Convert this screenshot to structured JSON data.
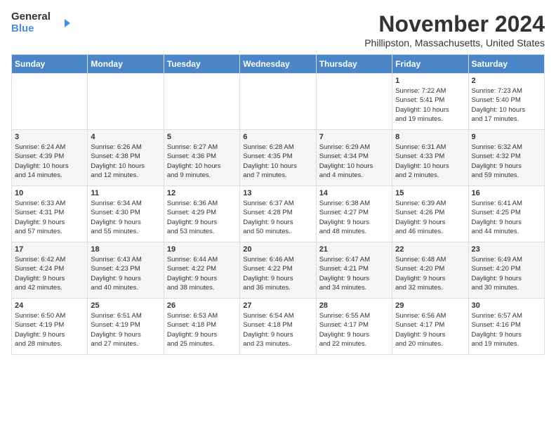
{
  "logo": {
    "line1": "General",
    "line2": "Blue"
  },
  "title": "November 2024",
  "location": "Phillipston, Massachusetts, United States",
  "days_of_week": [
    "Sunday",
    "Monday",
    "Tuesday",
    "Wednesday",
    "Thursday",
    "Friday",
    "Saturday"
  ],
  "weeks": [
    [
      {
        "day": "",
        "info": ""
      },
      {
        "day": "",
        "info": ""
      },
      {
        "day": "",
        "info": ""
      },
      {
        "day": "",
        "info": ""
      },
      {
        "day": "",
        "info": ""
      },
      {
        "day": "1",
        "info": "Sunrise: 7:22 AM\nSunset: 5:41 PM\nDaylight: 10 hours\nand 19 minutes."
      },
      {
        "day": "2",
        "info": "Sunrise: 7:23 AM\nSunset: 5:40 PM\nDaylight: 10 hours\nand 17 minutes."
      }
    ],
    [
      {
        "day": "3",
        "info": "Sunrise: 6:24 AM\nSunset: 4:39 PM\nDaylight: 10 hours\nand 14 minutes."
      },
      {
        "day": "4",
        "info": "Sunrise: 6:26 AM\nSunset: 4:38 PM\nDaylight: 10 hours\nand 12 minutes."
      },
      {
        "day": "5",
        "info": "Sunrise: 6:27 AM\nSunset: 4:36 PM\nDaylight: 10 hours\nand 9 minutes."
      },
      {
        "day": "6",
        "info": "Sunrise: 6:28 AM\nSunset: 4:35 PM\nDaylight: 10 hours\nand 7 minutes."
      },
      {
        "day": "7",
        "info": "Sunrise: 6:29 AM\nSunset: 4:34 PM\nDaylight: 10 hours\nand 4 minutes."
      },
      {
        "day": "8",
        "info": "Sunrise: 6:31 AM\nSunset: 4:33 PM\nDaylight: 10 hours\nand 2 minutes."
      },
      {
        "day": "9",
        "info": "Sunrise: 6:32 AM\nSunset: 4:32 PM\nDaylight: 9 hours\nand 59 minutes."
      }
    ],
    [
      {
        "day": "10",
        "info": "Sunrise: 6:33 AM\nSunset: 4:31 PM\nDaylight: 9 hours\nand 57 minutes."
      },
      {
        "day": "11",
        "info": "Sunrise: 6:34 AM\nSunset: 4:30 PM\nDaylight: 9 hours\nand 55 minutes."
      },
      {
        "day": "12",
        "info": "Sunrise: 6:36 AM\nSunset: 4:29 PM\nDaylight: 9 hours\nand 53 minutes."
      },
      {
        "day": "13",
        "info": "Sunrise: 6:37 AM\nSunset: 4:28 PM\nDaylight: 9 hours\nand 50 minutes."
      },
      {
        "day": "14",
        "info": "Sunrise: 6:38 AM\nSunset: 4:27 PM\nDaylight: 9 hours\nand 48 minutes."
      },
      {
        "day": "15",
        "info": "Sunrise: 6:39 AM\nSunset: 4:26 PM\nDaylight: 9 hours\nand 46 minutes."
      },
      {
        "day": "16",
        "info": "Sunrise: 6:41 AM\nSunset: 4:25 PM\nDaylight: 9 hours\nand 44 minutes."
      }
    ],
    [
      {
        "day": "17",
        "info": "Sunrise: 6:42 AM\nSunset: 4:24 PM\nDaylight: 9 hours\nand 42 minutes."
      },
      {
        "day": "18",
        "info": "Sunrise: 6:43 AM\nSunset: 4:23 PM\nDaylight: 9 hours\nand 40 minutes."
      },
      {
        "day": "19",
        "info": "Sunrise: 6:44 AM\nSunset: 4:22 PM\nDaylight: 9 hours\nand 38 minutes."
      },
      {
        "day": "20",
        "info": "Sunrise: 6:46 AM\nSunset: 4:22 PM\nDaylight: 9 hours\nand 36 minutes."
      },
      {
        "day": "21",
        "info": "Sunrise: 6:47 AM\nSunset: 4:21 PM\nDaylight: 9 hours\nand 34 minutes."
      },
      {
        "day": "22",
        "info": "Sunrise: 6:48 AM\nSunset: 4:20 PM\nDaylight: 9 hours\nand 32 minutes."
      },
      {
        "day": "23",
        "info": "Sunrise: 6:49 AM\nSunset: 4:20 PM\nDaylight: 9 hours\nand 30 minutes."
      }
    ],
    [
      {
        "day": "24",
        "info": "Sunrise: 6:50 AM\nSunset: 4:19 PM\nDaylight: 9 hours\nand 28 minutes."
      },
      {
        "day": "25",
        "info": "Sunrise: 6:51 AM\nSunset: 4:19 PM\nDaylight: 9 hours\nand 27 minutes."
      },
      {
        "day": "26",
        "info": "Sunrise: 6:53 AM\nSunset: 4:18 PM\nDaylight: 9 hours\nand 25 minutes."
      },
      {
        "day": "27",
        "info": "Sunrise: 6:54 AM\nSunset: 4:18 PM\nDaylight: 9 hours\nand 23 minutes."
      },
      {
        "day": "28",
        "info": "Sunrise: 6:55 AM\nSunset: 4:17 PM\nDaylight: 9 hours\nand 22 minutes."
      },
      {
        "day": "29",
        "info": "Sunrise: 6:56 AM\nSunset: 4:17 PM\nDaylight: 9 hours\nand 20 minutes."
      },
      {
        "day": "30",
        "info": "Sunrise: 6:57 AM\nSunset: 4:16 PM\nDaylight: 9 hours\nand 19 minutes."
      }
    ]
  ]
}
